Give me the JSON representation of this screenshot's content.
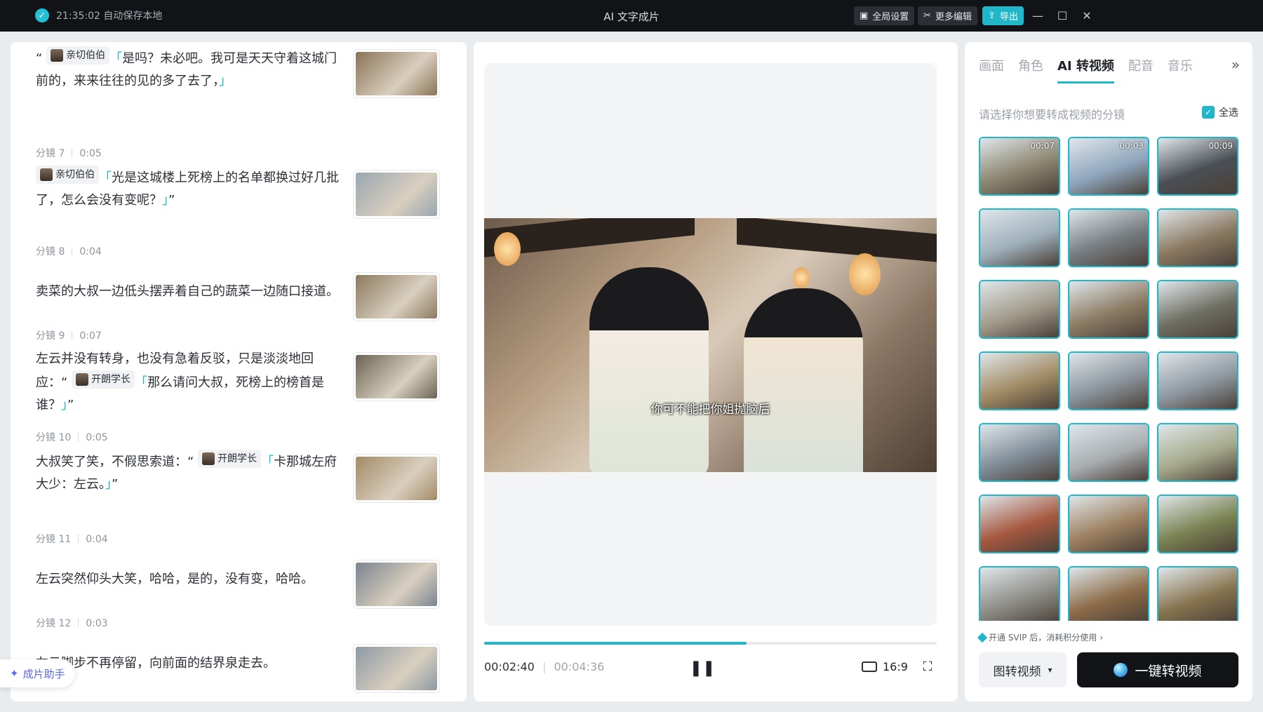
{
  "titlebar": {
    "save_status": "21:35:02 自动保存本地",
    "title": "AI 文字成片",
    "global_settings": "全局设置",
    "more_edit": "更多编辑",
    "export": "导出"
  },
  "segments": [
    {
      "label": "",
      "duration": "",
      "open": "“",
      "character": "亲切伯伯",
      "line": "是吗？未必吧。我可是天天守着这城门前的，来来往往的见的多了去了，",
      "close": "",
      "thumb": "#8a7356"
    },
    {
      "label": "分镜 7",
      "duration": "0:05",
      "open": "",
      "character": "亲切伯伯",
      "line": "光是这城楼上死榜上的名单都换过好几批了，怎么会没有变呢？",
      "close": "”",
      "thumb": "#9aa6b0"
    },
    {
      "label": "分镜 8",
      "duration": "0:04",
      "text": "卖菜的大叔一边低头摆弄着自己的蔬菜一边随口接道。",
      "thumb": "#8b7a5e"
    },
    {
      "label": "分镜 9",
      "duration": "0:07",
      "pre": "左云并没有转身，也没有急着反驳，只是淡淡地回应：",
      "open": "“",
      "character": "开朗学长",
      "line": "那么请问大叔，死榜上的榜首是谁？",
      "close": "”",
      "thumb": "#6b6354"
    },
    {
      "label": "分镜 10",
      "duration": "0:05",
      "pre": "大叔笑了笑，不假思索道：",
      "open": "“",
      "character": "开朗学长",
      "line": "卡那城左府大少：左云。",
      "close": "”",
      "thumb": "#a48a66"
    },
    {
      "label": "分镜 11",
      "duration": "0:04",
      "text": "左云突然仰头大笑，哈哈，是的，没有变，哈哈。",
      "thumb": "#7b8490"
    },
    {
      "label": "分镜 12",
      "duration": "0:03",
      "text": "左云脚步不再停留，向前面的结界泉走去。",
      "thumb": "#8e9aa3"
    }
  ],
  "assistant": "成片助手",
  "player": {
    "subtitle": "你可不能把你姐抛脑后",
    "current_time": "00:02:40",
    "total_time": "00:04:36",
    "progress": 0.58,
    "ratio": "16:9"
  },
  "panel": {
    "tabs": [
      "画面",
      "角色",
      "AI 转视频",
      "配音",
      "音乐"
    ],
    "active_tab": 2,
    "hint": "请选择你想要转成视频的分镜",
    "select_all": "全选",
    "shots": [
      {
        "dur": "00:07",
        "color": "#8c8570"
      },
      {
        "dur": "00:03",
        "color": "#8fa6bd"
      },
      {
        "dur": "00:09",
        "color": "#4a4f55"
      },
      {
        "dur": "",
        "color": "#9fb0bb"
      },
      {
        "dur": "",
        "color": "#767c80"
      },
      {
        "dur": "",
        "color": "#8a7860"
      },
      {
        "dur": "",
        "color": "#a19a8a"
      },
      {
        "dur": "",
        "color": "#8b7b63"
      },
      {
        "dur": "",
        "color": "#6e6e62"
      },
      {
        "dur": "",
        "color": "#a28b65"
      },
      {
        "dur": "",
        "color": "#8b949c"
      },
      {
        "dur": "",
        "color": "#8f98a0"
      },
      {
        "dur": "",
        "color": "#7f8c96"
      },
      {
        "dur": "",
        "color": "#a8adb0"
      },
      {
        "dur": "",
        "color": "#a5a98a"
      },
      {
        "dur": "",
        "color": "#a6583f"
      },
      {
        "dur": "",
        "color": "#9c7f60"
      },
      {
        "dur": "",
        "color": "#7a8252"
      },
      {
        "dur": "",
        "color": "#8e8d88"
      },
      {
        "dur": "",
        "color": "#8c6b48"
      },
      {
        "dur": "",
        "color": "#87734f"
      }
    ],
    "footer_note": "开通 SVIP 后，消耗积分使用",
    "mode": "图转视频",
    "convert": "一键转视频"
  }
}
